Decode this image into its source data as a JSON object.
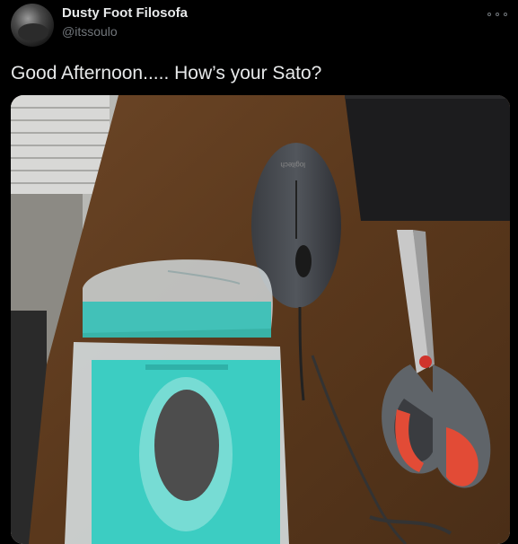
{
  "user": {
    "display_name": "Dusty Foot Filosofa",
    "handle": "@itssoulo"
  },
  "tweet": {
    "text": "Good Afternoon..... How’s your Sato?"
  },
  "icons": {
    "more": "more-options-icon",
    "avatar": "profile-avatar"
  },
  "media": {
    "mouse_brand": "logitech"
  },
  "colors": {
    "background": "#000000",
    "text_primary": "#e7e9ea",
    "text_secondary": "#71767b"
  }
}
